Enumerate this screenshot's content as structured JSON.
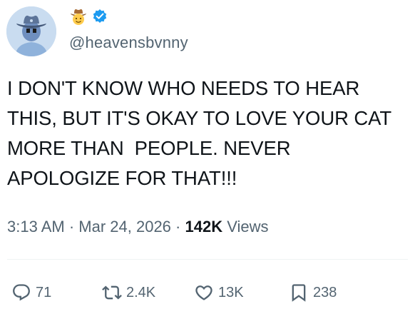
{
  "author": {
    "handle": "@heavensbvnny",
    "name_emoji": "cowboy-hat-face-emoji",
    "verified_icon": "verified-badge-icon",
    "verified_color": "#1d9bf0"
  },
  "tweet": {
    "lines": [
      "I DON'T KNOW WHO NEEDS TO HEAR",
      "THIS, BUT IT'S OKAY TO LOVE YOUR CAT",
      "MORE THAN  PEOPLE. NEVER",
      "APOLOGIZE FOR THAT!!!"
    ]
  },
  "meta": {
    "time": "3:13 AM",
    "separator": " · ",
    "date": "Mar 24, 2026",
    "views_count": "142K",
    "views_label": " Views"
  },
  "actions": {
    "reply": {
      "icon": "reply-icon",
      "count": "71"
    },
    "retweet": {
      "icon": "retweet-icon",
      "count": "2.4K"
    },
    "like": {
      "icon": "heart-icon",
      "count": "13K"
    },
    "bookmark": {
      "icon": "bookmark-icon",
      "count": "238"
    }
  },
  "colors": {
    "text": "#0f1419",
    "secondary": "#536471",
    "divider": "#eff3f4"
  }
}
